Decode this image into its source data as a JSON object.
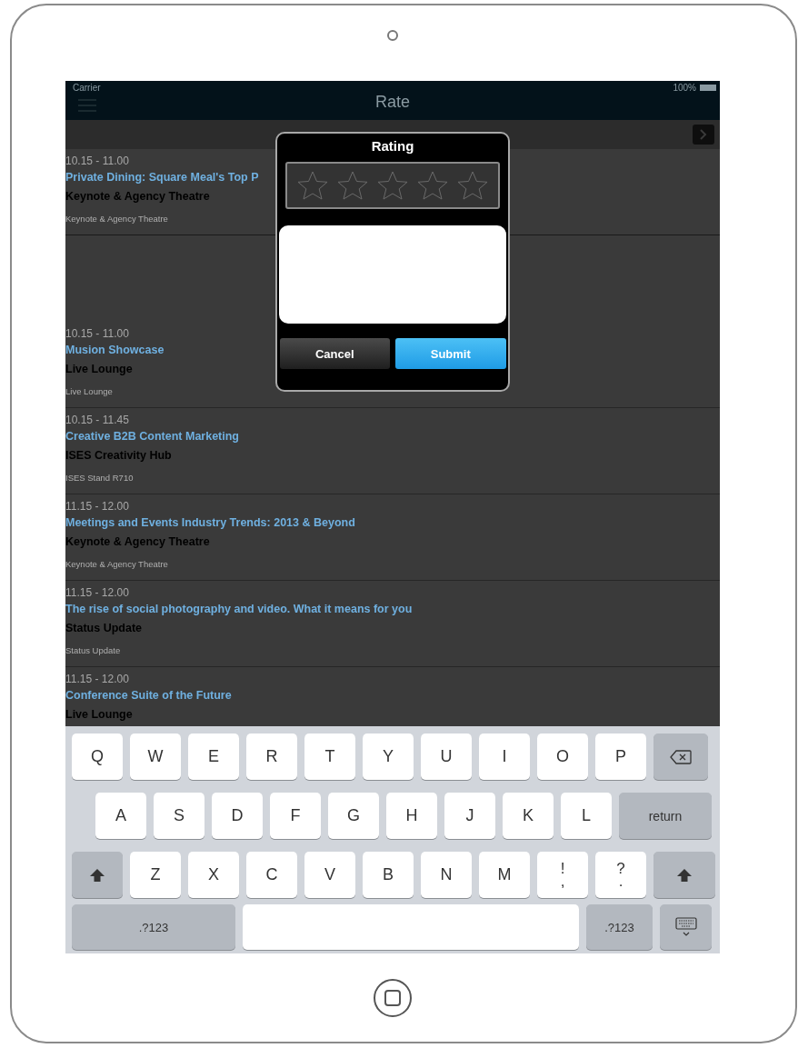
{
  "status_bar": {
    "carrier": "Carrier",
    "battery": "100%"
  },
  "nav": {
    "title": "Rate"
  },
  "sessions": [
    {
      "time": "10.15 - 11.00",
      "title": "Private Dining: Square Meal's Top P",
      "venue": "Keynote & Agency Theatre",
      "location": "Keynote & Agency Theatre"
    },
    {
      "time": "10.15 - 11.00",
      "title": "Musion Showcase",
      "venue": "Live Lounge",
      "location": "Live Lounge"
    },
    {
      "time": "10.15 - 11.45",
      "title": "Creative B2B Content Marketing",
      "venue": "ISES Creativity Hub",
      "location": "ISES Stand R710"
    },
    {
      "time": "11.15 - 12.00",
      "title": "Meetings and Events Industry Trends: 2013 & Beyond",
      "venue": "Keynote & Agency Theatre",
      "location": "Keynote & Agency Theatre"
    },
    {
      "time": "11.15 - 12.00",
      "title": "The rise of social photography and video. What it means for you",
      "venue": "Status Update",
      "location": "Status Update"
    },
    {
      "time": "11.15 - 12.00",
      "title": "Conference Suite of the Future",
      "venue": "Live Lounge"
    }
  ],
  "dialog": {
    "title": "Rating",
    "stars": 0,
    "buttons": [
      {
        "label": "Cancel",
        "kind": "cancel"
      },
      {
        "label": "Submit",
        "kind": "submit"
      }
    ]
  },
  "keyboard": [
    [
      {
        "kind": "letter",
        "label": "Q"
      },
      {
        "kind": "letter",
        "label": "W"
      },
      {
        "kind": "letter",
        "label": "E"
      },
      {
        "kind": "letter",
        "label": "R"
      },
      {
        "kind": "letter",
        "label": "T"
      },
      {
        "kind": "letter",
        "label": "Y"
      },
      {
        "kind": "letter",
        "label": "U"
      },
      {
        "kind": "letter",
        "label": "I"
      },
      {
        "kind": "letter",
        "label": "O"
      },
      {
        "kind": "letter",
        "label": "P"
      },
      {
        "kind": "backspace"
      }
    ],
    [
      {
        "kind": "letter",
        "label": "A"
      },
      {
        "kind": "letter",
        "label": "S"
      },
      {
        "kind": "letter",
        "label": "D"
      },
      {
        "kind": "letter",
        "label": "F"
      },
      {
        "kind": "letter",
        "label": "G"
      },
      {
        "kind": "letter",
        "label": "H"
      },
      {
        "kind": "letter",
        "label": "J"
      },
      {
        "kind": "letter",
        "label": "K"
      },
      {
        "kind": "letter",
        "label": "L"
      },
      {
        "kind": "return",
        "label": "return"
      }
    ],
    [
      {
        "kind": "shift"
      },
      {
        "kind": "letter",
        "label": "Z"
      },
      {
        "kind": "letter",
        "label": "X"
      },
      {
        "kind": "letter",
        "label": "C"
      },
      {
        "kind": "letter",
        "label": "V"
      },
      {
        "kind": "letter",
        "label": "B"
      },
      {
        "kind": "letter",
        "label": "N"
      },
      {
        "kind": "letter",
        "label": "M"
      },
      {
        "kind": "dual",
        "top": "!",
        "bottom": ","
      },
      {
        "kind": "dual",
        "top": "?",
        "bottom": "."
      },
      {
        "kind": "shift"
      }
    ],
    [
      {
        "kind": "mode",
        "label": ".?123",
        "wide": true
      },
      {
        "kind": "space"
      },
      {
        "kind": "mode",
        "label": ".?123",
        "wide": false
      },
      {
        "kind": "hide"
      }
    ]
  ]
}
